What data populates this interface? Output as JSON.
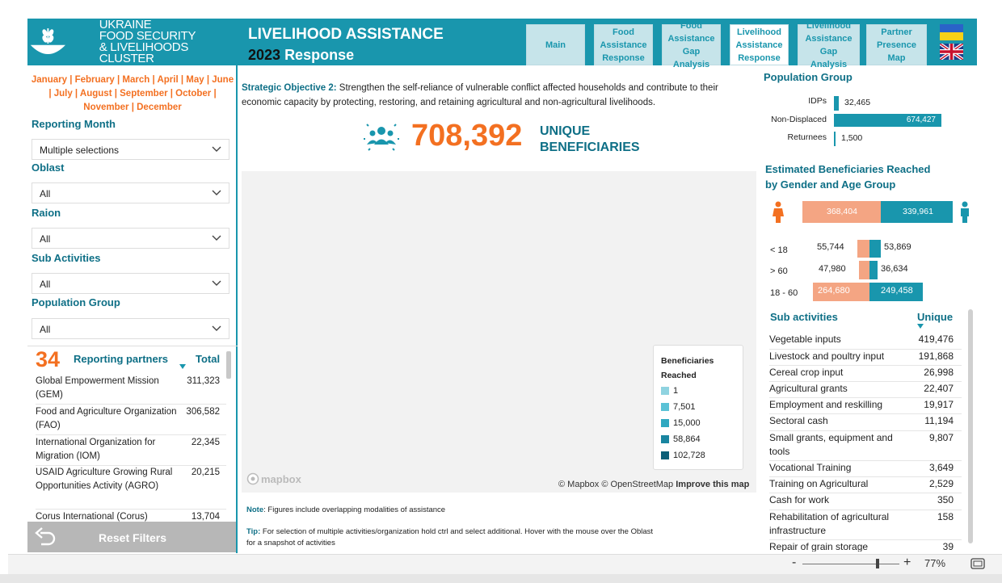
{
  "header": {
    "logo_line1": "UKRAINE",
    "logo_line2": "FOOD SECURITY",
    "logo_line3": "& LIVELIHOODS CLUSTER",
    "title": "LIVELIHOOD ASSISTANCE",
    "year": "2023",
    "response": "Response",
    "tabs": [
      {
        "label": "Main"
      },
      {
        "label": "Food Assistance Response"
      },
      {
        "label": "Food Assistance Gap Analysis"
      },
      {
        "label": "Livelihood Assistance Response"
      },
      {
        "label": "Livelihood Assistance Gap Analysis"
      },
      {
        "label": "Partner Presence Map"
      }
    ]
  },
  "filters": {
    "months": "January | February | March | April | May | June | July | August | September | October | November | December",
    "reporting_month_label": "Reporting Month",
    "reporting_month_value": "Multiple selections",
    "oblast_label": "Oblast",
    "oblast_value": "All",
    "raion_label": "Raion",
    "raion_value": "All",
    "sub_activities_label": "Sub Activities",
    "sub_activities_value": "All",
    "population_group_label": "Population Group",
    "population_group_value": "All"
  },
  "partners": {
    "count": "34",
    "header": "Reporting partners",
    "total_header": "Total",
    "rows": [
      {
        "name": "Global Empowerment Mission (GEM)",
        "value": "311,323"
      },
      {
        "name": "Food and Agriculture Organization (FAO)",
        "value": "306,582"
      },
      {
        "name": "International Organization for Migration (IOM)",
        "value": "22,345"
      },
      {
        "name": "USAID Agriculture Growing Rural Opportunities Activity (AGRO)",
        "value": "20,215"
      },
      {
        "name": "Corus International (Corus)",
        "value": "13,704"
      }
    ]
  },
  "reset_label": "Reset Filters",
  "objective": {
    "label": "Strategic Objective 2:",
    "text": " Strengthen the self-reliance of vulnerable conflict affected households and contribute to their economic capacity by protecting, restoring, and retaining agricultural and non-agricultural livelihoods."
  },
  "kpi": {
    "value": "708,392",
    "label_line1": "UNIQUE",
    "label_line2": "BENEFICIARIES"
  },
  "map": {
    "attribution": "© Mapbox © OpenStreetMap",
    "improve": "Improve this map",
    "logo": "mapbox",
    "legend_title_1": "Beneficiaries",
    "legend_title_2": "Reached",
    "legend": [
      {
        "label": "1",
        "color": "#8fd3e0"
      },
      {
        "label": "7,501",
        "color": "#5bc2d6"
      },
      {
        "label": "15,000",
        "color": "#2fa8c0"
      },
      {
        "label": "58,864",
        "color": "#1985a0"
      },
      {
        "label": "102,728",
        "color": "#0c5f78"
      }
    ]
  },
  "notes": {
    "note_label": "Note",
    "note_text": ": Figures include overlapping modalities of assistance",
    "tip_label": "Tip:",
    "tip_text": " For selection of multiple activities/organization hold ctrl and select additional. Hover with the mouse over the Oblast",
    "tip_text2": "for a snapshot of activities"
  },
  "population": {
    "title": "Population Group",
    "rows": [
      {
        "label": "IDPs",
        "value": "32,465",
        "num": 32465
      },
      {
        "label": "Non-Displaced",
        "value": "674,427",
        "num": 674427
      },
      {
        "label": "Returnees",
        "value": "1,500",
        "num": 1500
      }
    ]
  },
  "gender": {
    "title_line1": "Estimated Beneficiaries Reached",
    "title_line2": "by Gender and Age Group",
    "female_total": "368,404",
    "male_total": "339,961",
    "female_total_num": 368404,
    "male_total_num": 339961,
    "age_rows": [
      {
        "label": "< 18",
        "female": "55,744",
        "male": "53,869",
        "fnum": 55744,
        "mnum": 53869
      },
      {
        "label": "> 60",
        "female": "47,980",
        "male": "36,634",
        "fnum": 47980,
        "mnum": 36634
      },
      {
        "label": "18 - 60",
        "female": "264,680",
        "male": "249,458",
        "fnum": 264680,
        "mnum": 249458
      }
    ]
  },
  "sub_activities": {
    "title": "Sub activities",
    "col": "Unique",
    "rows": [
      {
        "name": "Vegetable inputs",
        "value": "419,476"
      },
      {
        "name": "Livestock and poultry input",
        "value": "191,868"
      },
      {
        "name": "Cereal crop input",
        "value": "26,998"
      },
      {
        "name": "Agricultural grants",
        "value": "22,407"
      },
      {
        "name": "Employment and reskilling",
        "value": "19,917"
      },
      {
        "name": "Sectoral cash",
        "value": "11,194"
      },
      {
        "name": "Small grants, equipment and tools",
        "value": "9,807"
      },
      {
        "name": "Vocational Training",
        "value": "3,649"
      },
      {
        "name": "Training on Agricultural",
        "value": "2,529"
      },
      {
        "name": "Cash for work",
        "value": "350"
      },
      {
        "name": "Rehabilitation of agricultural infrastructure",
        "value": "158"
      },
      {
        "name": "Repair of grain storage",
        "value": "39"
      }
    ]
  },
  "zoom": {
    "minus": "-",
    "plus": "+",
    "level": "77%"
  },
  "colors": {
    "teal": "#1996ad",
    "orange": "#f37021",
    "salmon": "#f4a583",
    "dark_teal": "#0e6f86"
  }
}
